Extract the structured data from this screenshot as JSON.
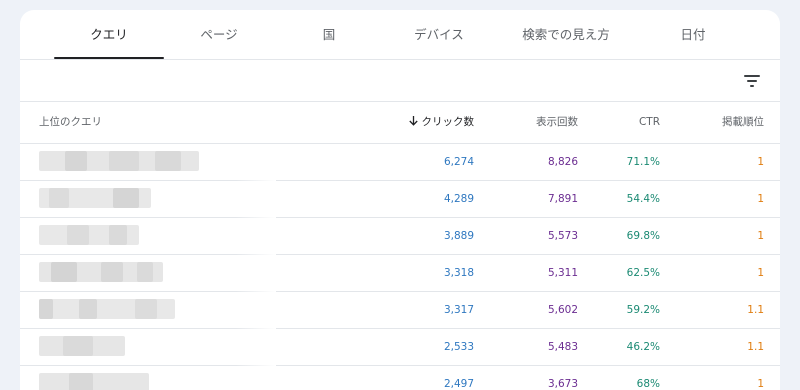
{
  "tabs": [
    {
      "label": "クエリ",
      "active": true
    },
    {
      "label": "ページ",
      "active": false
    },
    {
      "label": "国",
      "active": false
    },
    {
      "label": "デバイス",
      "active": false
    },
    {
      "label": "検索での見え方",
      "active": false
    },
    {
      "label": "日付",
      "active": false
    }
  ],
  "toolbar": {
    "filter_icon": "filter-list-icon"
  },
  "table": {
    "headers": {
      "query": "上位のクエリ",
      "clicks": "クリック数",
      "impressions": "表示回数",
      "ctr": "CTR",
      "position": "掲載順位"
    },
    "sort_icon": "arrow-downward-icon",
    "rows": [
      {
        "query": "",
        "clicks": "6,274",
        "impressions": "8,826",
        "ctr": "71.1%",
        "position": "1"
      },
      {
        "query": "",
        "clicks": "4,289",
        "impressions": "7,891",
        "ctr": "54.4%",
        "position": "1"
      },
      {
        "query": "",
        "clicks": "3,889",
        "impressions": "5,573",
        "ctr": "69.8%",
        "position": "1"
      },
      {
        "query": "",
        "clicks": "3,318",
        "impressions": "5,311",
        "ctr": "62.5%",
        "position": "1"
      },
      {
        "query": "",
        "clicks": "3,317",
        "impressions": "5,602",
        "ctr": "59.2%",
        "position": "1.1"
      },
      {
        "query": "",
        "clicks": "2,533",
        "impressions": "5,483",
        "ctr": "46.2%",
        "position": "1.1"
      },
      {
        "query": "",
        "clicks": "2,497",
        "impressions": "3,673",
        "ctr": "68%",
        "position": "1"
      }
    ]
  },
  "colors": {
    "clicks": "#2f78c0",
    "impressions": "#6b2d91",
    "ctr": "#1b8a73",
    "position": "#e07d10",
    "page_background": "#eef2f8"
  }
}
